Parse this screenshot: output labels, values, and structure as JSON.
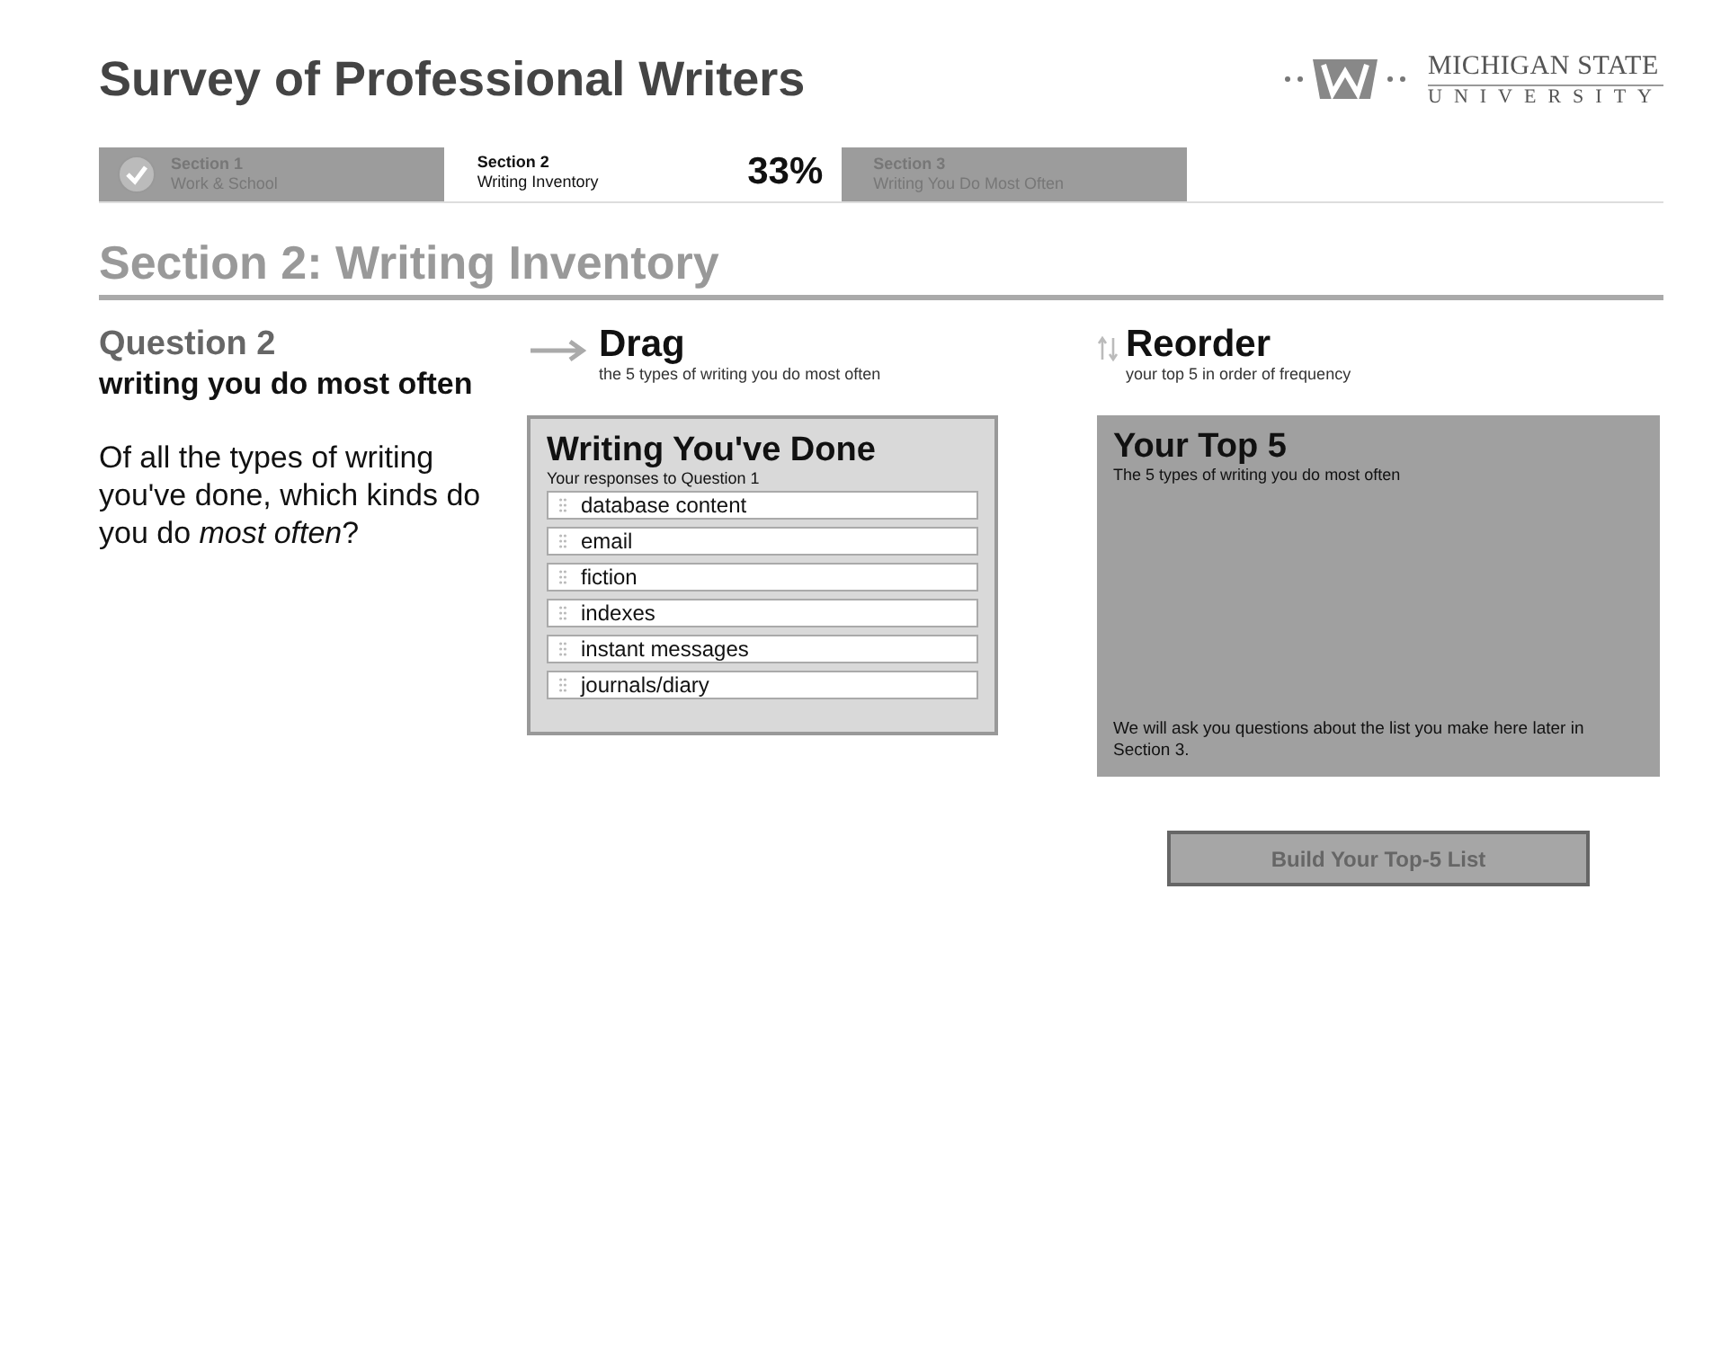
{
  "header": {
    "title": "Survey of Professional Writers",
    "logo_line_1": "MICHIGAN STATE",
    "logo_line_2": "UNIVERSITY"
  },
  "progress": {
    "percent": "33%",
    "sections": [
      {
        "title": "Section 1",
        "subtitle": "Work & School",
        "completed": true,
        "selected": false
      },
      {
        "title": "Section 2",
        "subtitle": "Writing Inventory",
        "completed": false,
        "selected": true
      },
      {
        "title": "Section 3",
        "subtitle": "Writing You Do Most Often",
        "completed": false,
        "selected": false
      }
    ]
  },
  "section_heading": "Section 2: Writing Inventory",
  "question": {
    "number": "Question 2",
    "topic": "writing you do most often",
    "prompt": "Of all the types of writing you've done, which kinds do you do *most often*?"
  },
  "drag": {
    "heading": "Drag",
    "hint": "the 5 types of writing you do most often",
    "box_title": "Writing You've Done",
    "box_subtitle": "Your responses to Question 1",
    "items": [
      "database content",
      "email",
      "fiction",
      "indexes",
      "instant messages",
      "journals/diary"
    ]
  },
  "reorder": {
    "heading": "Reorder",
    "hint": "your top 5 in order of frequency",
    "box_title": "Your Top 5",
    "box_subtitle": "The 5 types of writing you do most often",
    "note": "We will ask you questions about the list you make here later in Section 3."
  },
  "build_button": {
    "label": "Build Your Top-5 List",
    "disabled": true
  }
}
